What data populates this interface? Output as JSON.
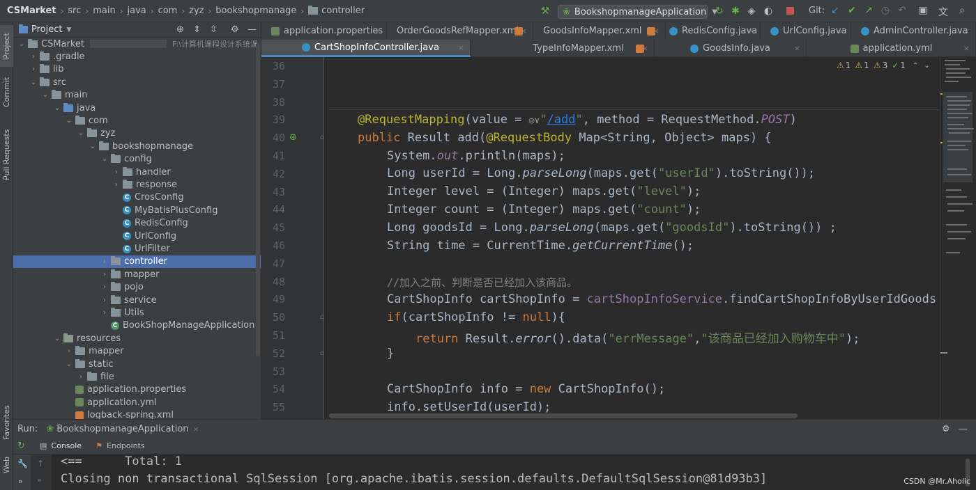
{
  "breadcrumb": {
    "project": "CSMarket",
    "parts": [
      "src",
      "main",
      "java",
      "com",
      "zyz",
      "bookshopmanage"
    ],
    "current": "controller"
  },
  "toolbar": {
    "run_config": "BookshopmanageApplication",
    "git_label": "Git:"
  },
  "side_tabs": {
    "project": "Project",
    "commit": "Commit",
    "pull_requests": "Pull Requests",
    "favorites": "Favorites",
    "web": "Web"
  },
  "project_panel": {
    "title": "Project",
    "tree": [
      {
        "label": "CSMarket",
        "suffix": "F:\\计算机课程设计系统课",
        "depth": 0,
        "arrow": "open",
        "icon": "folder"
      },
      {
        "label": ".gradle",
        "depth": 1,
        "arrow": "closed",
        "icon": "folder"
      },
      {
        "label": "lib",
        "depth": 1,
        "arrow": "closed",
        "icon": "folder"
      },
      {
        "label": "src",
        "depth": 1,
        "arrow": "open",
        "icon": "folder"
      },
      {
        "label": "main",
        "depth": 2,
        "arrow": "open",
        "icon": "folder"
      },
      {
        "label": "java",
        "depth": 3,
        "arrow": "open",
        "icon": "folder-blue"
      },
      {
        "label": "com",
        "depth": 4,
        "arrow": "open",
        "icon": "folder"
      },
      {
        "label": "zyz",
        "depth": 5,
        "arrow": "open",
        "icon": "folder"
      },
      {
        "label": "bookshopmanage",
        "depth": 6,
        "arrow": "open",
        "icon": "folder"
      },
      {
        "label": "config",
        "depth": 7,
        "arrow": "open",
        "icon": "folder"
      },
      {
        "label": "handler",
        "depth": 8,
        "arrow": "closed",
        "icon": "folder"
      },
      {
        "label": "response",
        "depth": 8,
        "arrow": "closed",
        "icon": "folder"
      },
      {
        "label": "CrosConfig",
        "depth": 8,
        "arrow": "none",
        "icon": "class"
      },
      {
        "label": "MyBatisPlusConfig",
        "depth": 8,
        "arrow": "none",
        "icon": "class"
      },
      {
        "label": "RedisConfig",
        "depth": 8,
        "arrow": "none",
        "icon": "class"
      },
      {
        "label": "UrlConfig",
        "depth": 8,
        "arrow": "none",
        "icon": "class"
      },
      {
        "label": "UrlFilter",
        "depth": 8,
        "arrow": "none",
        "icon": "class"
      },
      {
        "label": "controller",
        "depth": 7,
        "arrow": "closed",
        "icon": "folder",
        "selected": true
      },
      {
        "label": "mapper",
        "depth": 7,
        "arrow": "closed",
        "icon": "folder"
      },
      {
        "label": "pojo",
        "depth": 7,
        "arrow": "closed",
        "icon": "folder"
      },
      {
        "label": "service",
        "depth": 7,
        "arrow": "closed",
        "icon": "folder"
      },
      {
        "label": "Utils",
        "depth": 7,
        "arrow": "closed",
        "icon": "folder"
      },
      {
        "label": "BookShopManageApplication",
        "depth": 7,
        "arrow": "none",
        "icon": "spring-class"
      },
      {
        "label": "resources",
        "depth": 3,
        "arrow": "open",
        "icon": "folder-res"
      },
      {
        "label": "mapper",
        "depth": 4,
        "arrow": "closed",
        "icon": "folder"
      },
      {
        "label": "static",
        "depth": 4,
        "arrow": "open",
        "icon": "folder"
      },
      {
        "label": "file",
        "depth": 5,
        "arrow": "closed",
        "icon": "folder"
      },
      {
        "label": "application.properties",
        "depth": 4,
        "arrow": "none",
        "icon": "spring-file"
      },
      {
        "label": "application.yml",
        "depth": 4,
        "arrow": "none",
        "icon": "spring-file"
      },
      {
        "label": "logback-spring.xml",
        "depth": 4,
        "arrow": "none",
        "icon": "xml-file"
      }
    ]
  },
  "editor_tabs": {
    "row1": [
      {
        "label": "application.properties",
        "icon": "p"
      },
      {
        "label": "OrderGoodsRefMapper.xml",
        "icon": "x"
      },
      {
        "label": "GoodsInfoMapper.xml",
        "icon": "x"
      },
      {
        "label": "RedisConfig.java",
        "icon": "c"
      },
      {
        "label": "UrlConfig.java",
        "icon": "c"
      },
      {
        "label": "AdminController.java",
        "icon": "c"
      }
    ],
    "row2": [
      {
        "label": "CartShopInfoController.java",
        "icon": "c",
        "active": true
      },
      {
        "label": "TypeInfoMapper.xml",
        "icon": "x"
      },
      {
        "label": "GoodsInfo.java",
        "icon": "c"
      },
      {
        "label": "application.yml",
        "icon": "p"
      }
    ]
  },
  "inspections": {
    "warn_a": "1",
    "warn_b": "1",
    "weak": "3",
    "ok": "1"
  },
  "code": {
    "line_numbers": [
      "36",
      "37",
      "38",
      "39",
      "40",
      "41",
      "42",
      "43",
      "44",
      "45",
      "46",
      "47",
      "48",
      "49",
      "50",
      "51",
      "52",
      "53",
      "54",
      "55"
    ],
    "l39_annot": "@RequestMapping",
    "l39_a": "(value = ",
    "l39_url": "/add",
    "l39_b": ", method = RequestMethod.",
    "l39_post": "POST",
    "l39_c": ")",
    "l40_kw": "public ",
    "l40_a": "Result add(",
    "l40_annot": "@RequestBody",
    "l40_b": " Map<String, Object> maps) {",
    "l41_a": "System.",
    "l41_out": "out",
    "l41_b": ".println(maps);",
    "l42_a": "Long userId = Long.",
    "l42_m": "parseLong",
    "l42_b": "(maps.get(",
    "l42_s": "\"userId\"",
    "l42_c": ").toString());",
    "l43_a": "Integer level = (Integer) maps.get(",
    "l43_s": "\"level\"",
    "l43_b": ");",
    "l44_a": "Integer count = (Integer) maps.get(",
    "l44_s": "\"count\"",
    "l44_b": ");",
    "l45_a": "Long goodsId = Long.",
    "l45_m": "parseLong",
    "l45_b": "(maps.get(",
    "l45_s": "\"goodsId\"",
    "l45_c": ").toString()) ;",
    "l46_a": "String time = CurrentTime.",
    "l46_m": "getCurrentTime",
    "l46_b": "();",
    "l48_comment": "//加入之前、判断是否已经加入该商品。",
    "l49_a": "CartShopInfo cartShopInfo = ",
    "l49_f": "cartShopInfoService",
    "l49_b": ".findCartShopInfoByUserIdGoods",
    "l50_kw": "if",
    "l50_a": "(cartShopInfo != ",
    "l50_null": "null",
    "l50_b": "){",
    "l51_kw": "return ",
    "l51_a": "Result.",
    "l51_m": "error",
    "l51_b": "().data(",
    "l51_s1": "\"errMessage\"",
    "l51_c": ",",
    "l51_s2": "\"该商品已经加入购物车中\"",
    "l51_d": ");",
    "l52": "}",
    "l54_a": "CartShopInfo info = ",
    "l54_kw": "new ",
    "l54_b": "CartShopInfo();",
    "l55": "info.setUserId(userId);"
  },
  "run": {
    "label": "Run:",
    "config": "BookshopmanageApplication",
    "tab_console": "Console",
    "tab_endpoints": "Endpoints",
    "out1": "<==      Total: 1",
    "out2": "Closing non transactional SqlSession [org.apache.ibatis.session.defaults.DefaultSqlSession@81d93b3]"
  },
  "watermark": "CSDN @Mr.Aholic",
  "colors": {
    "keyword": "#cc7832",
    "string": "#6a8759",
    "annotation": "#bbb529",
    "selection": "#4b6eaf"
  }
}
